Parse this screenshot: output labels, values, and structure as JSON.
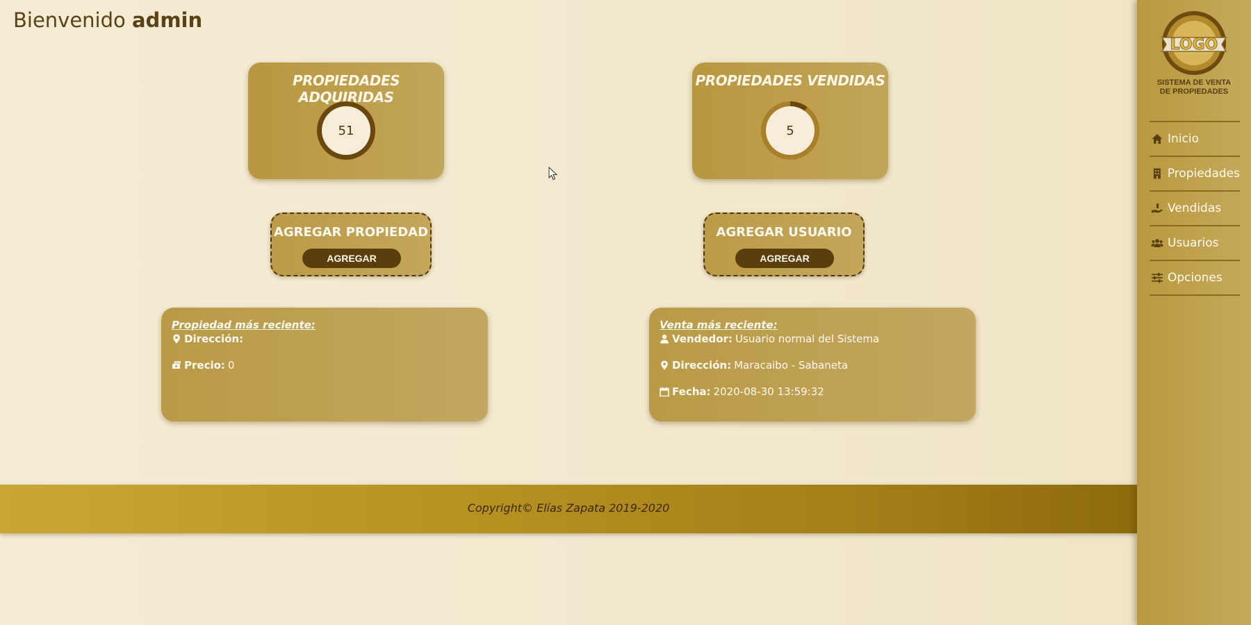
{
  "header": {
    "welcome_prefix": "Bienvenido",
    "username": "admin"
  },
  "stats": [
    {
      "title": "PROPIEDADES ADQUIRIDAS",
      "value": "51"
    },
    {
      "title": "PROPIEDADES VENDIDAS",
      "value": "5"
    }
  ],
  "actions": [
    {
      "title": "AGREGAR PROPIEDAD",
      "button": "AGREGAR"
    },
    {
      "title": "AGREGAR USUARIO",
      "button": "AGREGAR"
    }
  ],
  "recent_property": {
    "heading": "Propiedad más reciente:",
    "address_label": "Dirección:",
    "address_value": "",
    "price_label": "Precio:",
    "price_value": "0"
  },
  "recent_sale": {
    "heading": "Venta más reciente:",
    "seller_label": "Vendedor:",
    "seller_value": "Usuario normal del Sistema",
    "address_label": "Dirección:",
    "address_value": "Maracaibo - Sabaneta",
    "date_label": "Fecha:",
    "date_value": "2020-08-30 13:59:32"
  },
  "footer": {
    "copyright": "Copyright© Elías Zapata 2019-2020"
  },
  "sidebar": {
    "logo_text": "LOGO",
    "caption_line1": "SISTEMA DE VENTA",
    "caption_line2": "DE PROPIEDADES",
    "items": [
      {
        "label": "Inicio",
        "icon": "home-icon"
      },
      {
        "label": "Propiedades",
        "icon": "building-icon"
      },
      {
        "label": "Vendidas",
        "icon": "hand-money-icon"
      },
      {
        "label": "Usuarios",
        "icon": "users-icon"
      },
      {
        "label": "Opciones",
        "icon": "sliders-icon"
      }
    ]
  },
  "colors": {
    "accent_dark": "#5c3e0c",
    "card_gold": "#bb9b47",
    "background": "#f4ead1"
  }
}
